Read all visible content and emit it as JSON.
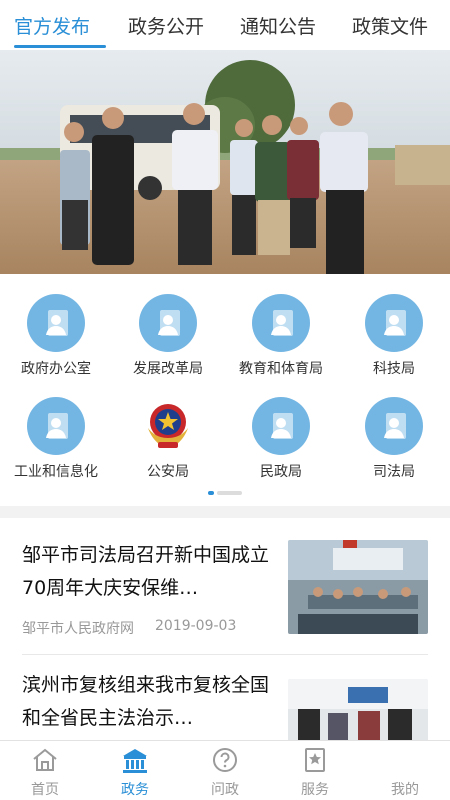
{
  "tabs": [
    "官方发布",
    "政务公开",
    "通知公告",
    "政策文件"
  ],
  "active_tab": 0,
  "banner": {
    "image": "officials-inspecting-construction-site-photo",
    "slide_count": 1,
    "active_slide": 0
  },
  "departments": [
    {
      "label": "政府办公室",
      "icon": "person-card-icon"
    },
    {
      "label": "发展改革局",
      "icon": "person-card-icon"
    },
    {
      "label": "教育和体育局",
      "icon": "person-card-icon"
    },
    {
      "label": "科技局",
      "icon": "person-card-icon"
    },
    {
      "label": "工业和信息化",
      "icon": "person-card-icon"
    },
    {
      "label": "公安局",
      "icon": "police-emblem-icon"
    },
    {
      "label": "民政局",
      "icon": "person-card-icon"
    },
    {
      "label": "司法局",
      "icon": "person-card-icon"
    }
  ],
  "grid_pages": {
    "count": 2,
    "active": 0
  },
  "news": [
    {
      "title": "邹平市司法局召开新中国成立70周年大庆安保维…",
      "source": "邹平市人民政府网",
      "date": "2019-09-03",
      "thumb": "meeting-room-photo"
    },
    {
      "title": "滨州市复核组来我市复核全国和全省民主法治示…",
      "source": "",
      "date": "",
      "thumb": "office-visit-photo"
    }
  ],
  "bottom_nav": [
    {
      "label": "首页",
      "icon": "home-icon"
    },
    {
      "label": "政务",
      "icon": "government-building-icon"
    },
    {
      "label": "问政",
      "icon": "question-bubble-icon"
    },
    {
      "label": "服务",
      "icon": "star-document-icon"
    },
    {
      "label": "我的",
      "icon": ""
    }
  ],
  "active_nav": 1,
  "colors": {
    "accent": "#2a8fd6",
    "icon_circle": "#74b6e3",
    "muted": "#999999"
  }
}
